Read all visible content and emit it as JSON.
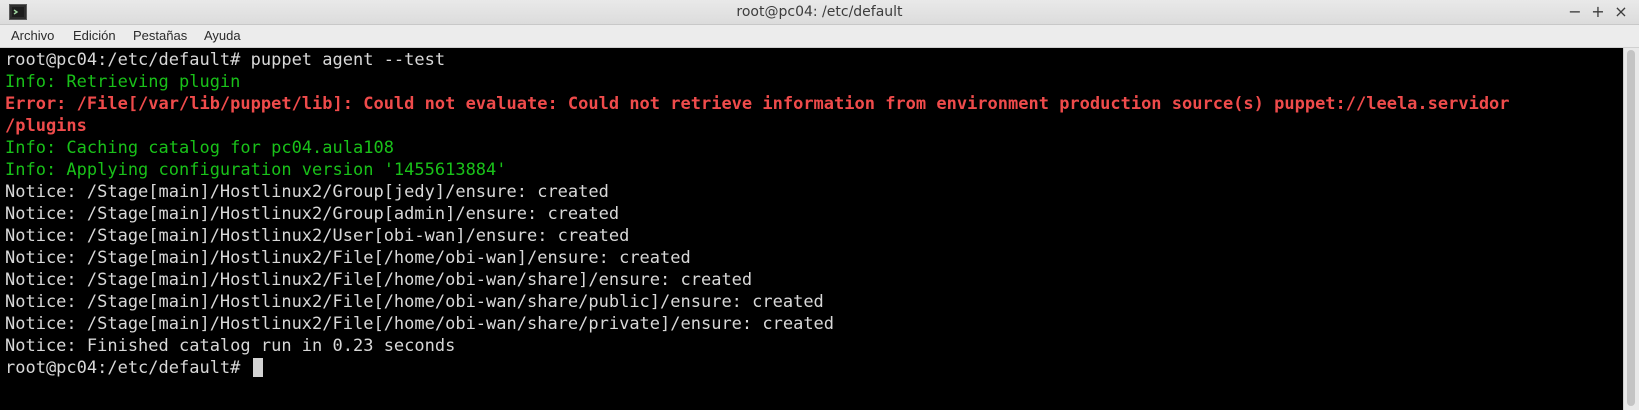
{
  "window": {
    "title": "root@pc04: /etc/default",
    "controls": {
      "minimize": "−",
      "maximize": "+",
      "close": "×"
    },
    "icon": "terminal-app-icon"
  },
  "menu": [
    "Archivo",
    "Edición",
    "Pestañas",
    "Ayuda"
  ],
  "terminal": {
    "lines": [
      {
        "text": "root@pc04:/etc/default# puppet agent --test",
        "kind": "plain"
      },
      {
        "text": "Info: Retrieving plugin",
        "kind": "info"
      },
      {
        "text": "Error: /File[/var/lib/puppet/lib]: Could not evaluate: Could not retrieve information from environment production source(s) puppet://leela.servidor",
        "kind": "error"
      },
      {
        "text": "/plugins",
        "kind": "error"
      },
      {
        "text": "Info: Caching catalog for pc04.aula108",
        "kind": "info"
      },
      {
        "text": "Info: Applying configuration version '1455613884'",
        "kind": "info"
      },
      {
        "text": "Notice: /Stage[main]/Hostlinux2/Group[jedy]/ensure: created",
        "kind": "plain"
      },
      {
        "text": "Notice: /Stage[main]/Hostlinux2/Group[admin]/ensure: created",
        "kind": "plain"
      },
      {
        "text": "Notice: /Stage[main]/Hostlinux2/User[obi-wan]/ensure: created",
        "kind": "plain"
      },
      {
        "text": "Notice: /Stage[main]/Hostlinux2/File[/home/obi-wan]/ensure: created",
        "kind": "plain"
      },
      {
        "text": "Notice: /Stage[main]/Hostlinux2/File[/home/obi-wan/share]/ensure: created",
        "kind": "plain"
      },
      {
        "text": "Notice: /Stage[main]/Hostlinux2/File[/home/obi-wan/share/public]/ensure: created",
        "kind": "plain"
      },
      {
        "text": "Notice: /Stage[main]/Hostlinux2/File[/home/obi-wan/share/private]/ensure: created",
        "kind": "plain"
      },
      {
        "text": "Notice: Finished catalog run in 0.23 seconds",
        "kind": "plain"
      },
      {
        "text": "root@pc04:/etc/default# ",
        "kind": "prompt"
      }
    ]
  },
  "colors": {
    "background": "#000000",
    "info": "#19c119",
    "error": "#ef4b4b",
    "text": "#d8d8d8"
  }
}
